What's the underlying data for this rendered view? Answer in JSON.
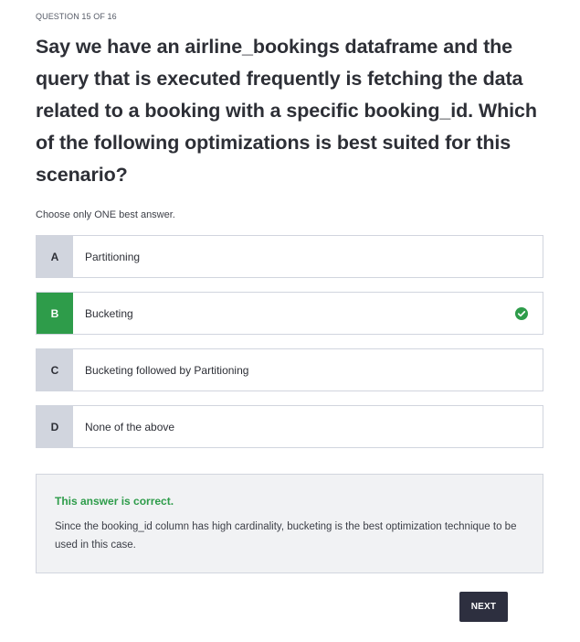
{
  "header": {
    "progress": "QUESTION 15 OF 16"
  },
  "question": {
    "text": "Say we have an airline_bookings dataframe and the query that is executed frequently is fetching the data related to a booking with a specific booking_id. Which of the following optimizations is best suited for this scenario?",
    "instruction": "Choose only ONE best answer."
  },
  "options": [
    {
      "letter": "A",
      "label": "Partitioning",
      "correct": false
    },
    {
      "letter": "B",
      "label": "Bucketing",
      "correct": true
    },
    {
      "letter": "C",
      "label": "Bucketing followed by Partitioning",
      "correct": false
    },
    {
      "letter": "D",
      "label": "None of the above",
      "correct": false
    }
  ],
  "feedback": {
    "title": "This answer is correct.",
    "body": "Since the booking_id column has high cardinality, bucketing is the best optimization technique to be used in this case."
  },
  "actions": {
    "next_label": "NEXT"
  },
  "icons": {
    "correct_option": "check-circle-icon"
  },
  "colors": {
    "correct": "#2e9c4a",
    "option_letter_bg": "#d1d5de",
    "next_button_bg": "#2d2f3f"
  }
}
